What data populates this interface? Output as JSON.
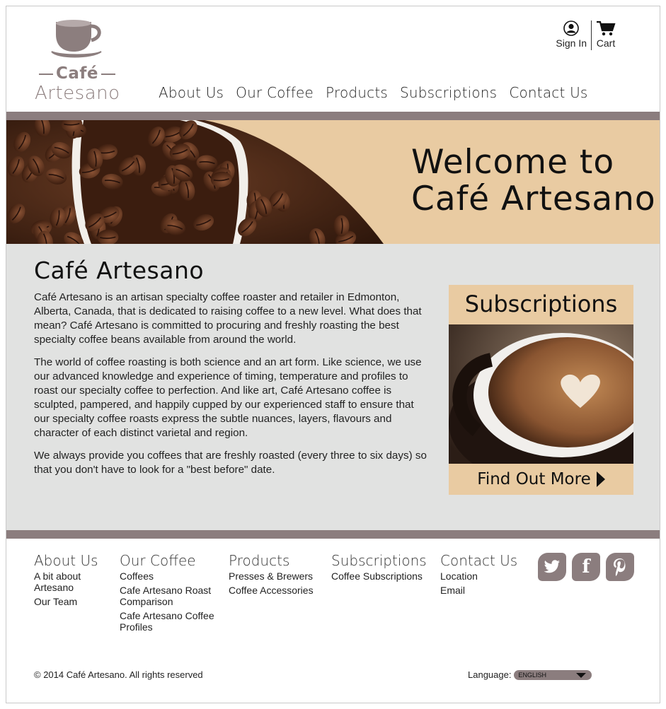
{
  "brand": {
    "name_line1": "Café",
    "name_line2": "Artesano"
  },
  "account": {
    "sign_in": "Sign In",
    "cart": "Cart"
  },
  "nav": [
    "About Us",
    "Our Coffee",
    "Products",
    "Subscriptions",
    "Contact Us"
  ],
  "hero": {
    "line1": "Welcome to",
    "line2": "Café Artesano"
  },
  "main": {
    "title": "Café Artesano",
    "paragraphs": [
      "Café Artesano is an artisan specialty coffee roaster and retailer in Edmonton, Alberta, Canada, that is dedicated to raising coffee to a new level. What does that mean? Café Artesano is committed to procuring and freshly roasting the best specialty coffee beans available from around the world.",
      "The world of coffee roasting is both science and an art form. Like science, we use our advanced knowledge and experience of timing, temperature and profiles to roast our specialty coffee to perfection. And like art, Café Artesano coffee is sculpted, pampered, and happily cupped by our experienced staff to ensure that our specialty coffee roasts express the subtle nuances, layers, flavours and character of each distinct varietal and region.",
      "We always provide you coffees that are freshly roasted (every three to six days) so that you don't have to look for a \"best before\" date."
    ]
  },
  "promo": {
    "title": "Subscriptions",
    "cta": "Find Out More"
  },
  "footer": {
    "columns": [
      {
        "heading": "About Us",
        "links": [
          "A bit about Artesano",
          "Our Team"
        ]
      },
      {
        "heading": "Our Coffee",
        "links": [
          "Coffees",
          "Cafe Artesano Roast Comparison",
          "Cafe Artesano Coffee Profiles"
        ]
      },
      {
        "heading": "Products",
        "links": [
          "Presses & Brewers",
          "Coffee Accessories"
        ]
      },
      {
        "heading": "Subscriptions",
        "links": [
          "Coffee Subscriptions"
        ]
      },
      {
        "heading": "Contact Us",
        "links": [
          "Location",
          "Email"
        ]
      }
    ],
    "social": [
      "twitter-icon",
      "facebook-icon",
      "pinterest-icon"
    ],
    "copyright": "© 2014 Café Artesano. All rights reserved",
    "language_label": "Language:",
    "language_value": "ENGLISH"
  },
  "colors": {
    "accent_band": "#8b7d7e",
    "tan": "#e9cba2",
    "content_bg": "#e1e2e1"
  }
}
